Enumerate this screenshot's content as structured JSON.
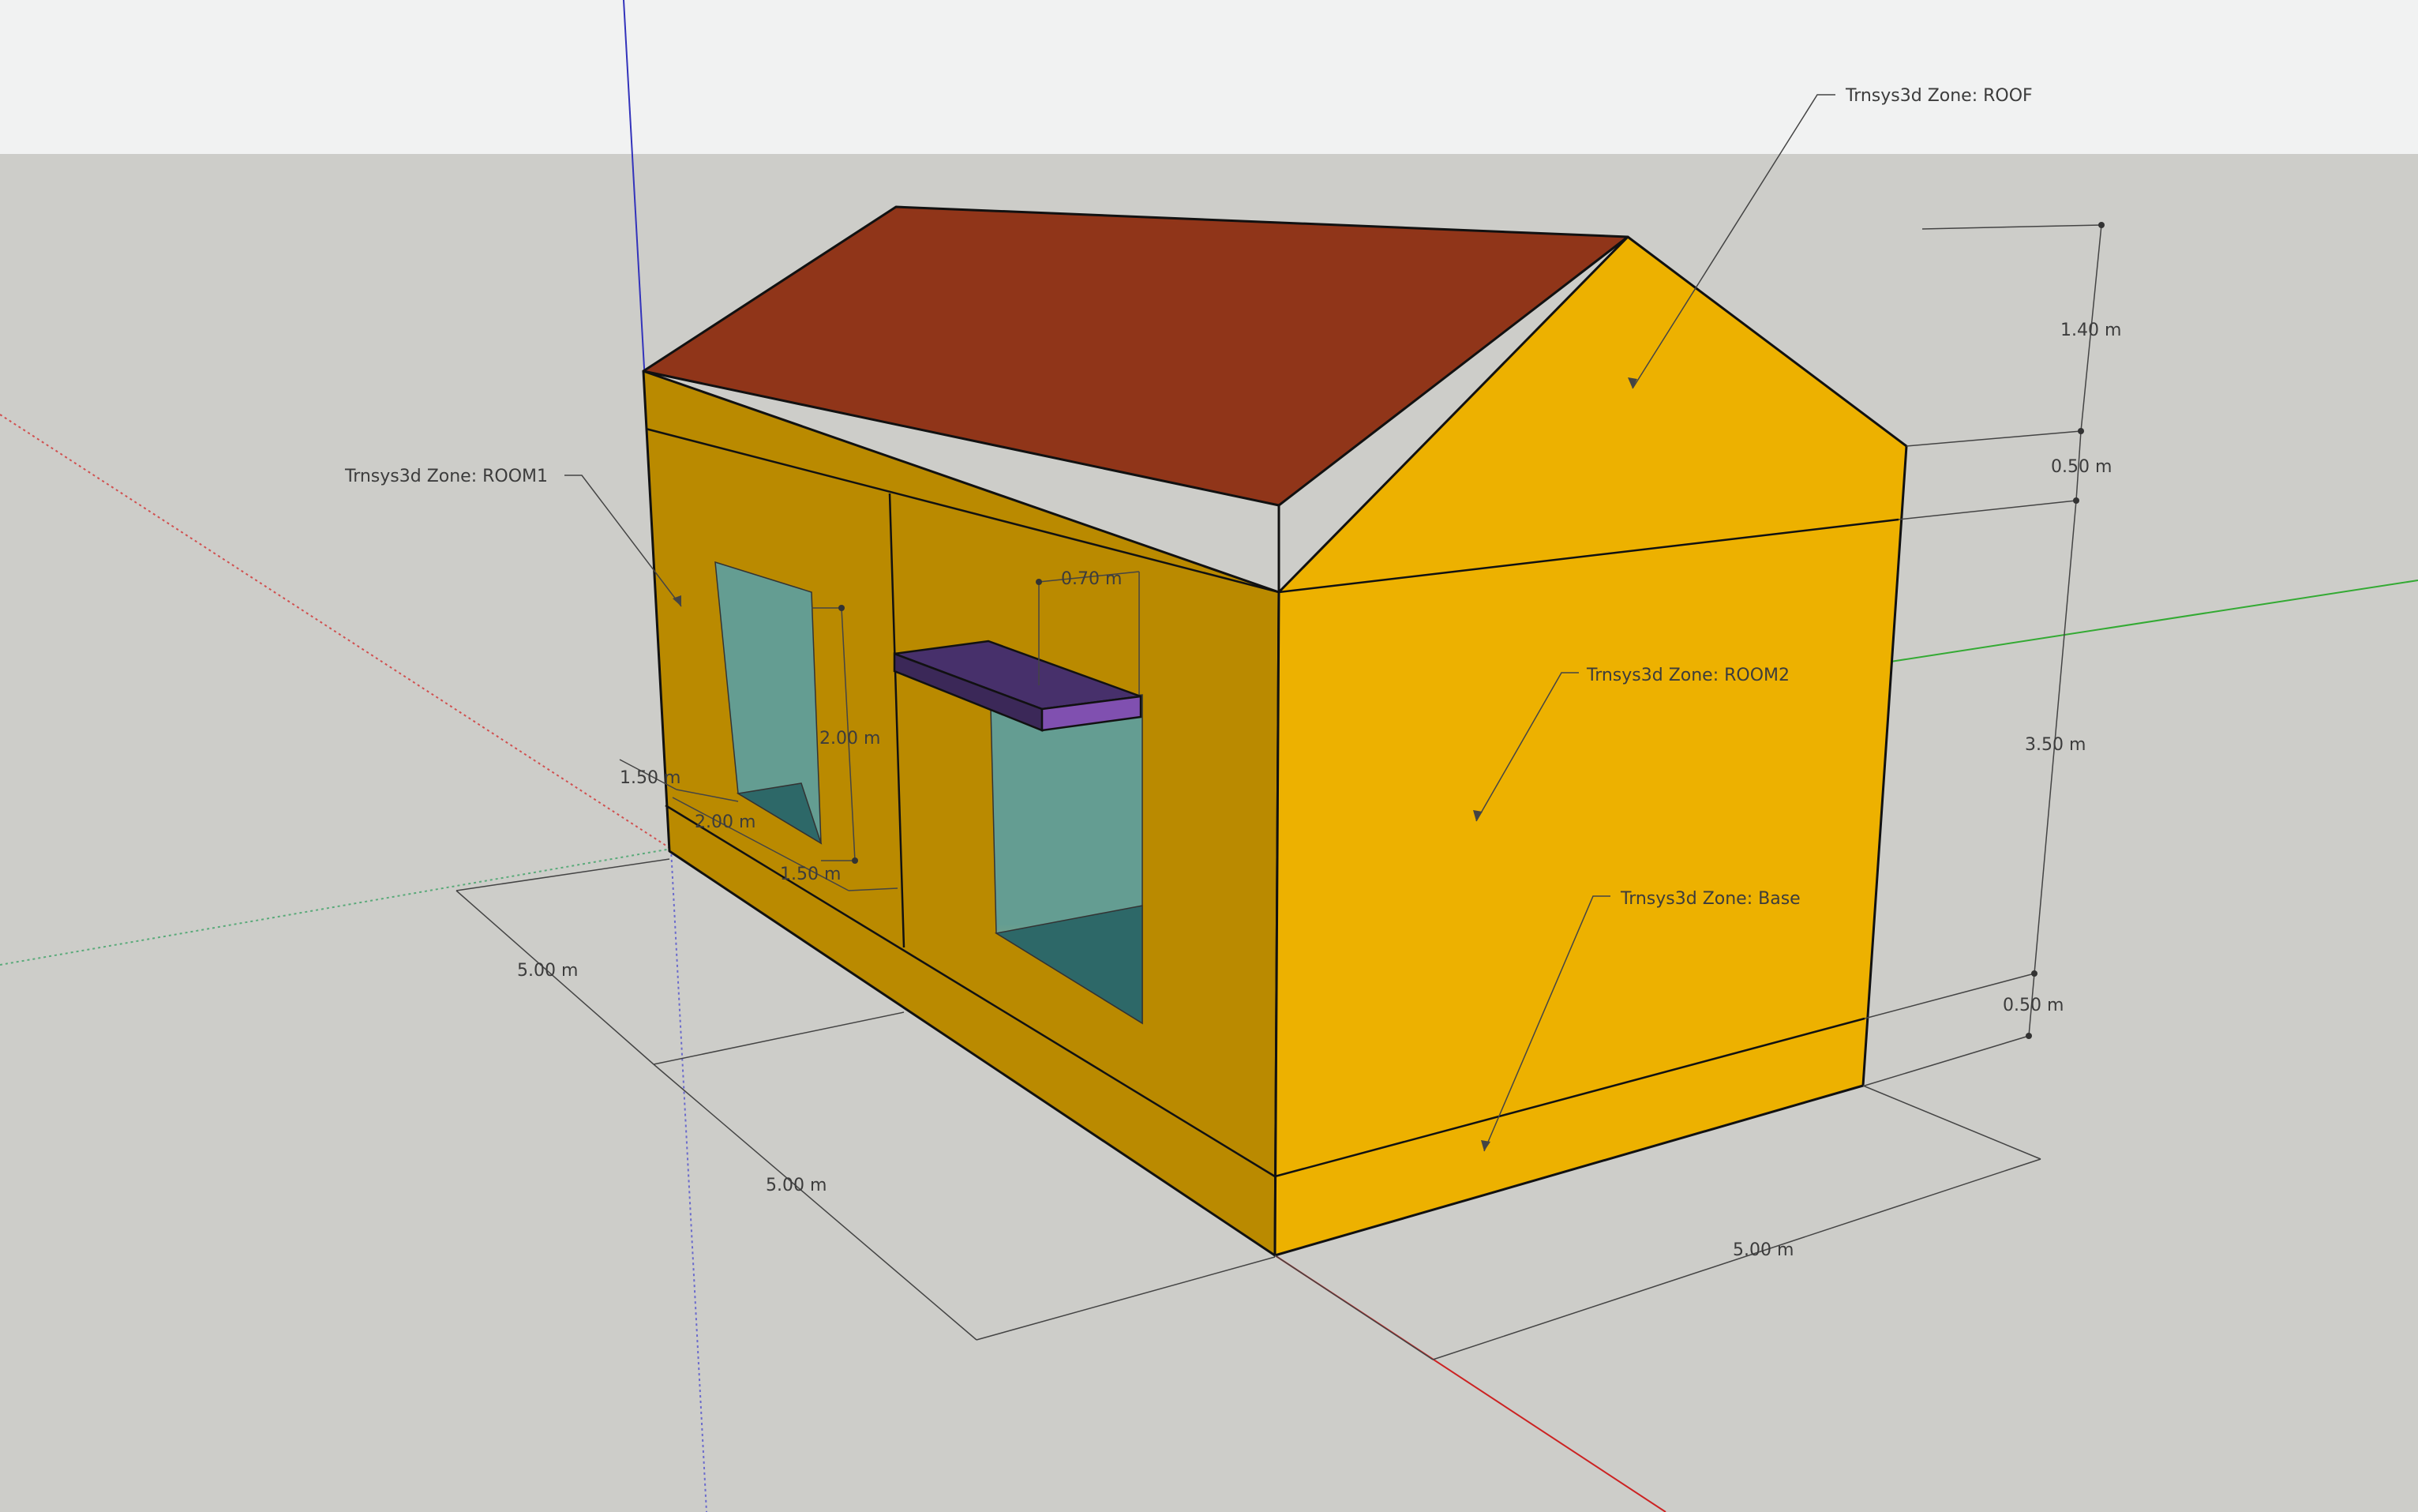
{
  "colors": {
    "sky": "#f1f2f2",
    "ground": "#cdcdc9",
    "roof": "#903519",
    "wall_light": "#edb100",
    "wall_dark": "#ba8a00",
    "glass_light": "#649d92",
    "glass_dark": "#2d6868",
    "shade_top": "#47306b",
    "shade_front": "#8050b0",
    "axis_red": "#cc2222",
    "axis_green": "#33aa33",
    "axis_blue": "#3333bb"
  },
  "zone_labels": {
    "roof": "Trnsys3d Zone:  ROOF",
    "room1": "Trnsys3d Zone:  ROOM1",
    "room2": "Trnsys3d Zone:  ROOM2",
    "base": "Trnsys3d Zone:  Base"
  },
  "dimensions": {
    "roof_height": "1.40 m",
    "eave_band": "0.50 m",
    "wall_height": "3.50 m",
    "base_height": "0.50 m",
    "depth_right": "5.00 m",
    "length_left_1": "5.00 m",
    "length_left_2": "5.00 m",
    "window_height": "2.00 m",
    "window_width": "2.00 m",
    "window_offset_left": "1.50 m",
    "window_offset_right": "1.50 m",
    "shade_depth": "0.70 m"
  }
}
